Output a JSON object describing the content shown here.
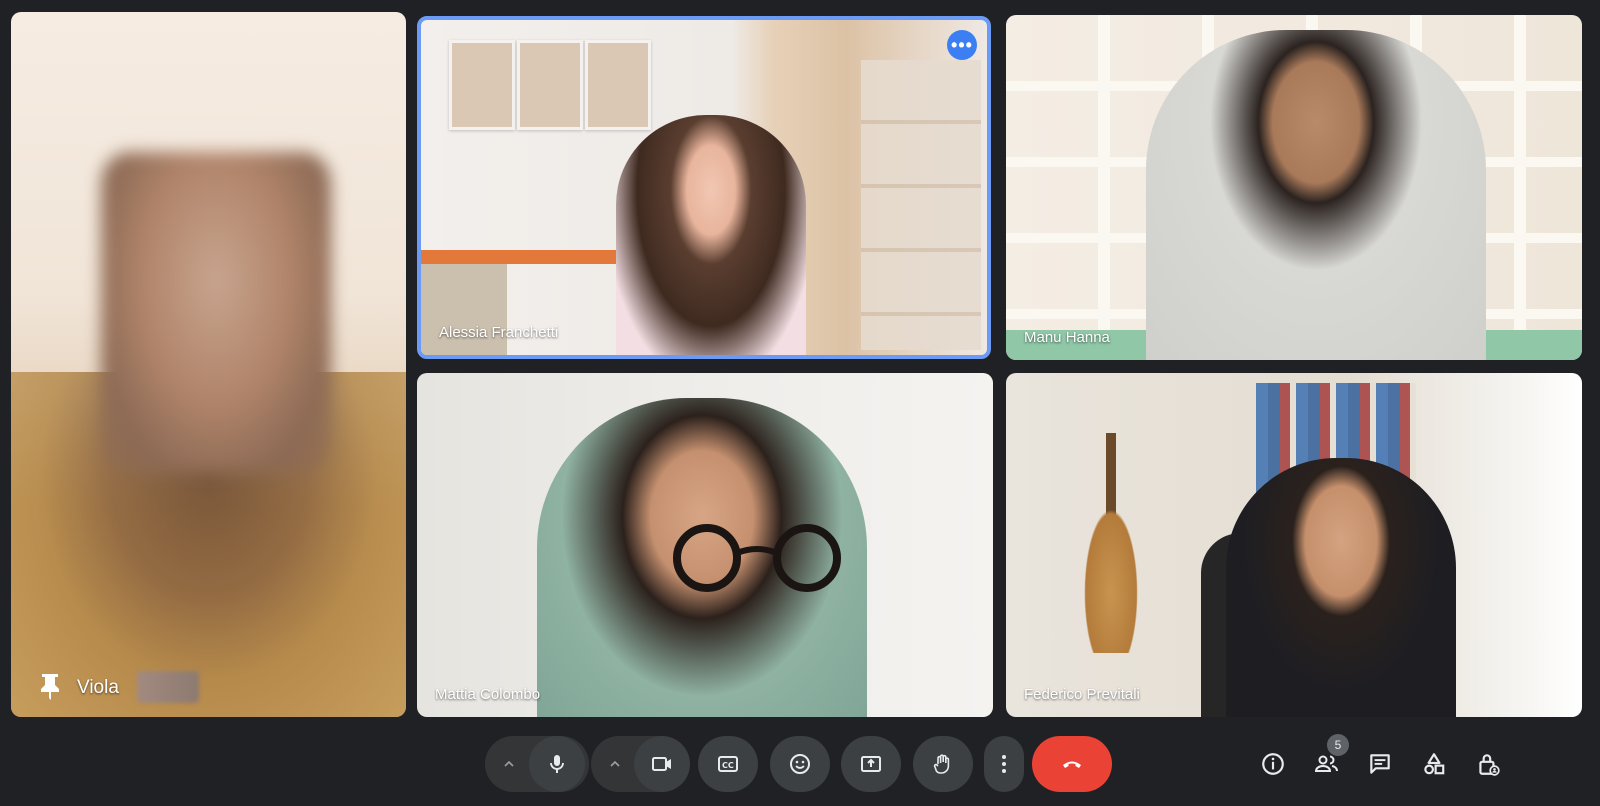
{
  "participants": [
    {
      "name": "Viola",
      "pinned": true
    },
    {
      "name": "Alessia Franchetti",
      "active": true
    },
    {
      "name": "Manu Hanna"
    },
    {
      "name": "Mattia Colombo"
    },
    {
      "name": "Federico Previtali"
    }
  ],
  "people_count": "5",
  "colors": {
    "background": "#202124",
    "control": "#3c4043",
    "hangup": "#ea4335",
    "active_border": "#6b9bf5",
    "more_button": "#3b7ff2"
  },
  "icons": {
    "more": "more-horizontal-icon",
    "pin": "pin-icon",
    "mic": "microphone-icon",
    "camera": "camera-icon",
    "captions": "captions-icon",
    "emoji": "emoji-icon",
    "present": "present-screen-icon",
    "raise_hand": "raise-hand-icon",
    "more_options": "more-vertical-icon",
    "hangup": "hangup-icon",
    "info": "info-icon",
    "people": "people-icon",
    "chat": "chat-icon",
    "activities": "activities-icon",
    "host_controls": "host-controls-icon"
  }
}
